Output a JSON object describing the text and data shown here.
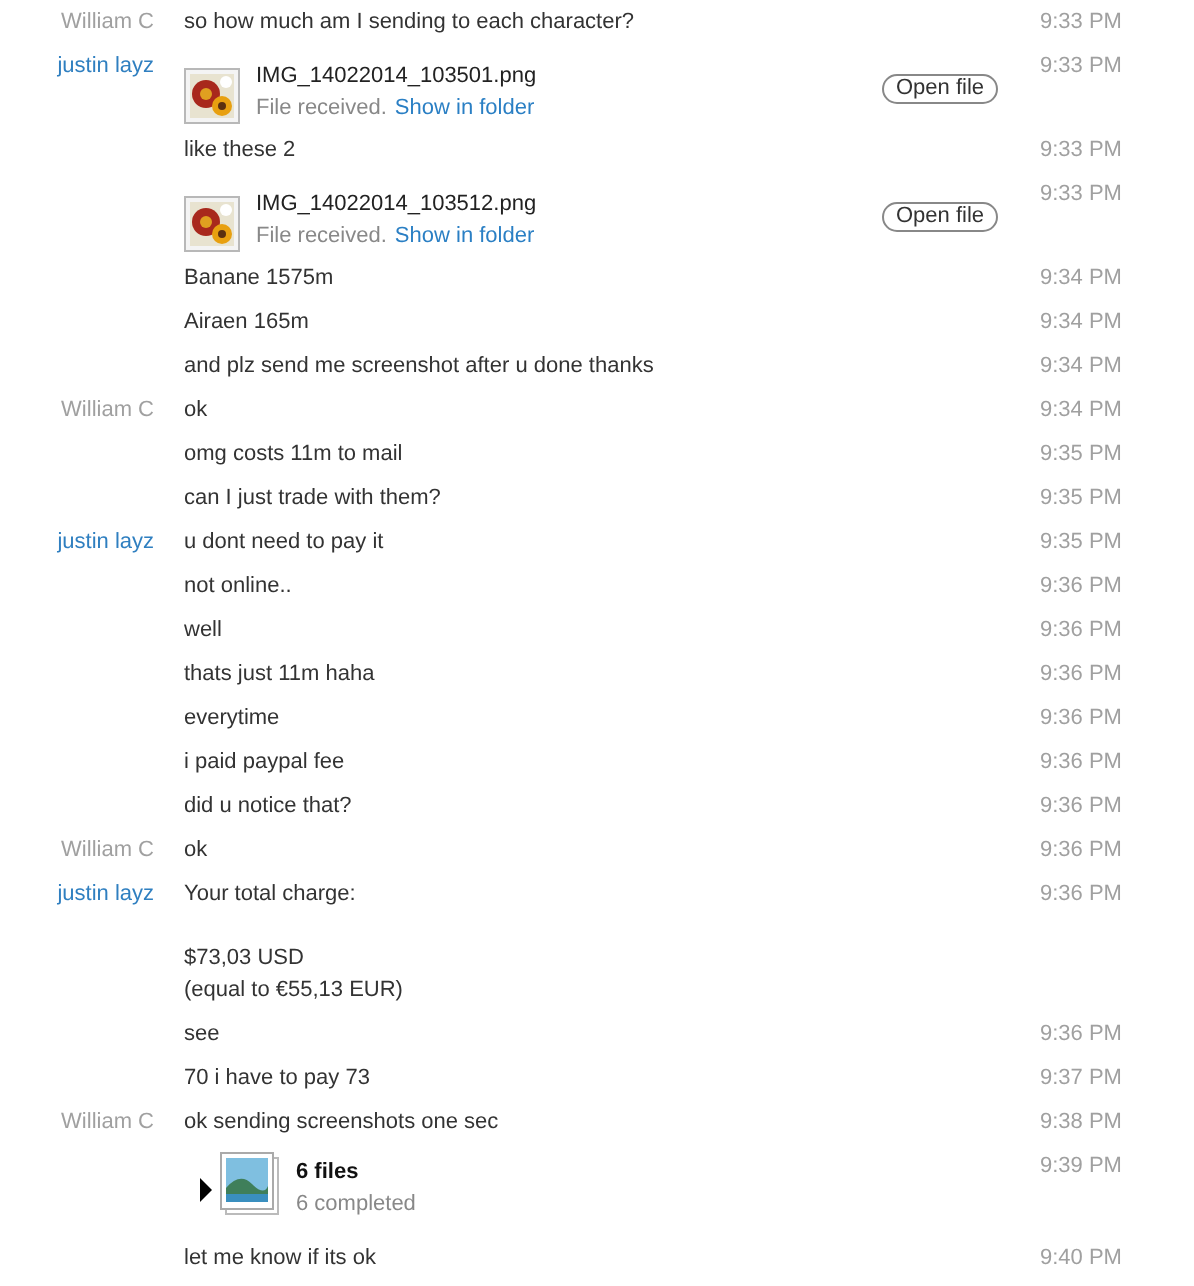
{
  "messages": [
    {
      "kind": "text",
      "sender": {
        "name": "William C",
        "color": "#a0a0a0"
      },
      "text": "so how much am I sending to each character?",
      "time": "9:33 PM"
    },
    {
      "kind": "file",
      "sender": {
        "name": "justin layz",
        "color": "#2f7fc0"
      },
      "file_name": "IMG_14022014_103501.png",
      "status": "File received.",
      "link": "Show in folder",
      "button": "Open file",
      "time": "9:33 PM"
    },
    {
      "kind": "text",
      "text": "like these 2",
      "time": "9:33 PM"
    },
    {
      "kind": "file",
      "file_name": "IMG_14022014_103512.png",
      "status": "File received.",
      "link": "Show in folder",
      "button": "Open file",
      "time": "9:33 PM"
    },
    {
      "kind": "text",
      "text": "Banane 1575m",
      "time": "9:34 PM"
    },
    {
      "kind": "text",
      "text": "Airaen 165m",
      "time": "9:34 PM"
    },
    {
      "kind": "text",
      "text": "and plz send me screenshot after u done thanks",
      "time": "9:34 PM"
    },
    {
      "kind": "text",
      "sender": {
        "name": "William C",
        "color": "#a0a0a0"
      },
      "text": "ok",
      "time": "9:34 PM"
    },
    {
      "kind": "text",
      "text": "omg costs 11m to mail",
      "time": "9:35 PM"
    },
    {
      "kind": "text",
      "text": "can I just trade with them?",
      "time": "9:35 PM"
    },
    {
      "kind": "text",
      "sender": {
        "name": "justin layz",
        "color": "#2f7fc0"
      },
      "text": "u dont need to pay it",
      "time": "9:35 PM"
    },
    {
      "kind": "text",
      "text": "not online..",
      "time": "9:36 PM"
    },
    {
      "kind": "text",
      "text": "well",
      "time": "9:36 PM"
    },
    {
      "kind": "text",
      "text": "thats just 11m haha",
      "time": "9:36 PM"
    },
    {
      "kind": "text",
      "text": "everytime",
      "time": "9:36 PM"
    },
    {
      "kind": "text",
      "text": "i paid paypal fee",
      "time": "9:36 PM"
    },
    {
      "kind": "text",
      "text": "did u notice that?",
      "time": "9:36 PM"
    },
    {
      "kind": "text",
      "sender": {
        "name": "William C",
        "color": "#a0a0a0"
      },
      "text": "ok",
      "time": "9:36 PM"
    },
    {
      "kind": "text",
      "sender": {
        "name": "justin layz",
        "color": "#2f7fc0"
      },
      "text": "Your total charge:\n\n$73,03 USD\n(equal to €55,13 EUR)",
      "time": "9:36 PM"
    },
    {
      "kind": "text",
      "text": "see",
      "time": "9:36 PM"
    },
    {
      "kind": "text",
      "text": "70 i have to pay 73",
      "time": "9:37 PM"
    },
    {
      "kind": "text",
      "sender": {
        "name": "William C",
        "color": "#a0a0a0"
      },
      "text": "ok sending screenshots one sec",
      "time": "9:38 PM"
    },
    {
      "kind": "files",
      "title": "6 files",
      "status": "6 completed",
      "time": "9:39 PM"
    },
    {
      "kind": "text",
      "text": "let me know if its ok",
      "time": "9:40 PM"
    }
  ]
}
